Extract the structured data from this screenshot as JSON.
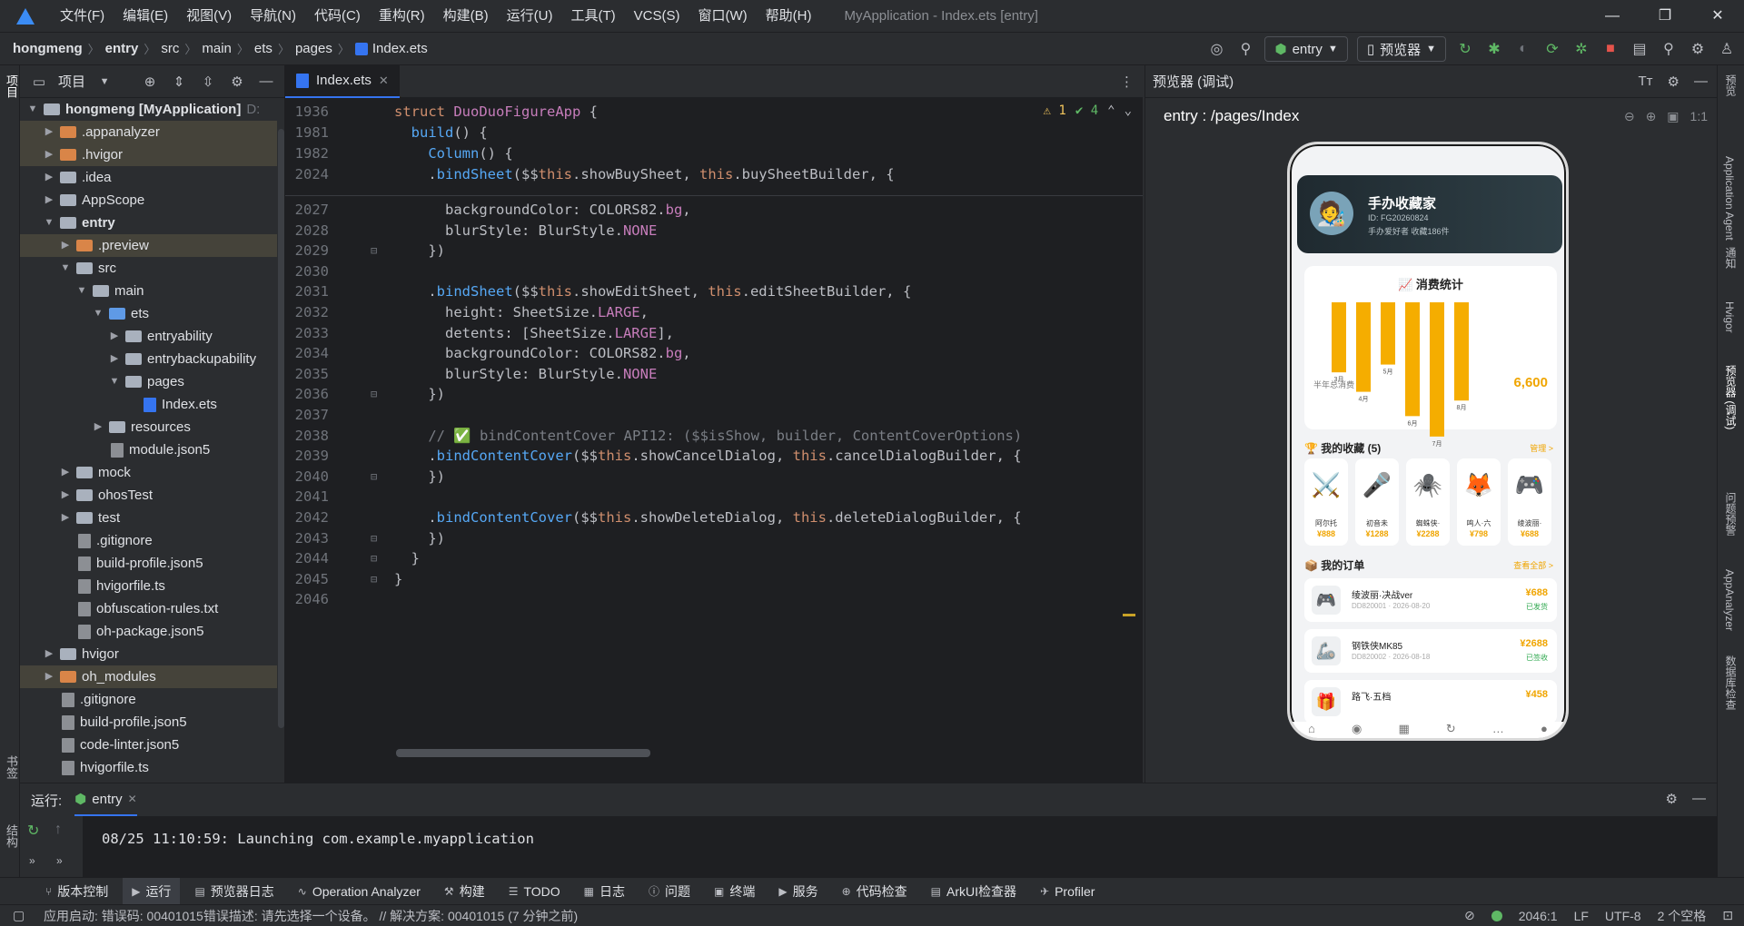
{
  "titlebar": {
    "menu": [
      "文件(F)",
      "编辑(E)",
      "视图(V)",
      "导航(N)",
      "代码(C)",
      "重构(R)",
      "构建(B)",
      "运行(U)",
      "工具(T)",
      "VCS(S)",
      "窗口(W)",
      "帮助(H)"
    ],
    "title": "MyApplication - Index.ets [entry]"
  },
  "breadcrumb": [
    "hongmeng",
    "entry",
    "src",
    "main",
    "ets",
    "pages",
    "Index.ets"
  ],
  "toolbar": {
    "module": "entry",
    "device": "预览器"
  },
  "project": {
    "header": "项目",
    "root": "hongmeng [MyApplication]",
    "root_suffix": "D:",
    "items": [
      {
        "label": ".appanalyzer"
      },
      {
        "label": ".hvigor"
      },
      {
        "label": ".idea"
      },
      {
        "label": "AppScope"
      },
      {
        "label": "entry"
      },
      {
        "label": ".preview"
      },
      {
        "label": "src"
      },
      {
        "label": "main"
      },
      {
        "label": "ets"
      },
      {
        "label": "entryability"
      },
      {
        "label": "entrybackupability"
      },
      {
        "label": "pages"
      },
      {
        "label": "Index.ets"
      },
      {
        "label": "resources"
      },
      {
        "label": "module.json5"
      },
      {
        "label": "mock"
      },
      {
        "label": "ohosTest"
      },
      {
        "label": "test"
      },
      {
        "label": ".gitignore"
      },
      {
        "label": "build-profile.json5"
      },
      {
        "label": "hvigorfile.ts"
      },
      {
        "label": "obfuscation-rules.txt"
      },
      {
        "label": "oh-package.json5"
      },
      {
        "label": "hvigor"
      },
      {
        "label": "oh_modules"
      },
      {
        "label": ".gitignore"
      },
      {
        "label": "build-profile.json5"
      },
      {
        "label": "code-linter.json5"
      },
      {
        "label": "hvigorfile.ts"
      }
    ]
  },
  "editor": {
    "tab": "Index.ets",
    "warnings": "1",
    "checks": "4",
    "sticky": [
      {
        "ln": "1936",
        "code": "struct DuoDuoFigureApp {"
      },
      {
        "ln": "1981",
        "code": "  build() {"
      },
      {
        "ln": "1982",
        "code": "    Column() {"
      },
      {
        "ln": "2024",
        "code": "    .bindSheet($$this.showBuySheet, this.buySheetBuilder, {"
      }
    ],
    "lines": [
      {
        "ln": "2027",
        "code": "      backgroundColor: COLORS82.bg,"
      },
      {
        "ln": "2028",
        "code": "      blurStyle: BlurStyle.NONE"
      },
      {
        "ln": "2029",
        "code": "    })"
      },
      {
        "ln": "2030",
        "code": ""
      },
      {
        "ln": "2031",
        "code": "    .bindSheet($$this.showEditSheet, this.editSheetBuilder, {"
      },
      {
        "ln": "2032",
        "code": "      height: SheetSize.LARGE,"
      },
      {
        "ln": "2033",
        "code": "      detents: [SheetSize.LARGE],"
      },
      {
        "ln": "2034",
        "code": "      backgroundColor: COLORS82.bg,"
      },
      {
        "ln": "2035",
        "code": "      blurStyle: BlurStyle.NONE"
      },
      {
        "ln": "2036",
        "code": "    })"
      },
      {
        "ln": "2037",
        "code": ""
      },
      {
        "ln": "2038",
        "code": "    // ✅ bindContentCover API12: ($$isShow, builder, ContentCoverOptions)"
      },
      {
        "ln": "2039",
        "code": "    .bindContentCover($$this.showCancelDialog, this.cancelDialogBuilder, {"
      },
      {
        "ln": "2040",
        "code": "    })"
      },
      {
        "ln": "2041",
        "code": ""
      },
      {
        "ln": "2042",
        "code": "    .bindContentCover($$this.showDeleteDialog, this.deleteDialogBuilder, {"
      },
      {
        "ln": "2043",
        "code": "    })"
      },
      {
        "ln": "2044",
        "code": "  }"
      },
      {
        "ln": "2045",
        "code": "}"
      },
      {
        "ln": "2046",
        "code": ""
      }
    ]
  },
  "preview": {
    "header": "预览器 (调试)",
    "path": "entry : /pages/Index",
    "phone": {
      "name": "手办收藏家",
      "id": "ID: FG20260824",
      "sub": "手办爱好者   收藏186件",
      "stats_title": "📈 消费统计",
      "total_label": "半年总消费",
      "total_value": "6,600",
      "months": [
        "3月",
        "4月",
        "5月",
        "6月",
        "7月",
        "8月"
      ],
      "month_values": [
        720,
        920,
        640,
        1170,
        1380,
        1010
      ],
      "collection_title": "🏆 我的收藏 (5)",
      "collection_link": "管理 >",
      "collection": [
        {
          "icon": "⚔️",
          "name": "阿尔托",
          "price": "¥888"
        },
        {
          "icon": "🎤",
          "name": "初音未",
          "price": "¥1288"
        },
        {
          "icon": "🕷️",
          "name": "蜘蛛侠·",
          "price": "¥2288"
        },
        {
          "icon": "🦊",
          "name": "鸣人·六",
          "price": "¥798"
        },
        {
          "icon": "🎮",
          "name": "绫波丽·",
          "price": "¥688"
        }
      ],
      "orders_title": "📦 我的订单",
      "orders_link": "查看全部 >",
      "orders": [
        {
          "icon": "🎮",
          "title": "绫波丽·决战ver",
          "sub": "DD820001 · 2026-08-20",
          "price": "¥688",
          "status": "已发货"
        },
        {
          "icon": "🦾",
          "title": "钢铁侠MK85",
          "sub": "DD820002 · 2026-08-18",
          "price": "¥2688",
          "status": "已签收"
        },
        {
          "icon": "🎁",
          "title": "路飞·五档",
          "sub": "",
          "price": "¥458",
          "status": ""
        }
      ]
    }
  },
  "right_strip": [
    "预览",
    "Application Agent",
    "通知",
    "Hvigor",
    "预览器 (调试)",
    "问题预警",
    "AppAnalyzer",
    "数据库检查"
  ],
  "left_strip": [
    "项目",
    "书签",
    "结构"
  ],
  "run": {
    "label": "运行:",
    "tab": "entry",
    "log": "08/25 11:10:59: Launching com.example.myapplication"
  },
  "tooltabs": [
    "版本控制",
    "运行",
    "预览器日志",
    "Operation Analyzer",
    "构建",
    "TODO",
    "日志",
    "问题",
    "终端",
    "服务",
    "代码检查",
    "ArkUI检查器",
    "Profiler"
  ],
  "status": {
    "message": "应用启动: 错误码: 00401015错误描述: 请先选择一个设备。 // 解决方案: 00401015 (7 分钟之前)",
    "position": "2046:1",
    "line_sep": "LF",
    "encoding": "UTF-8",
    "indent": "2 个空格"
  }
}
